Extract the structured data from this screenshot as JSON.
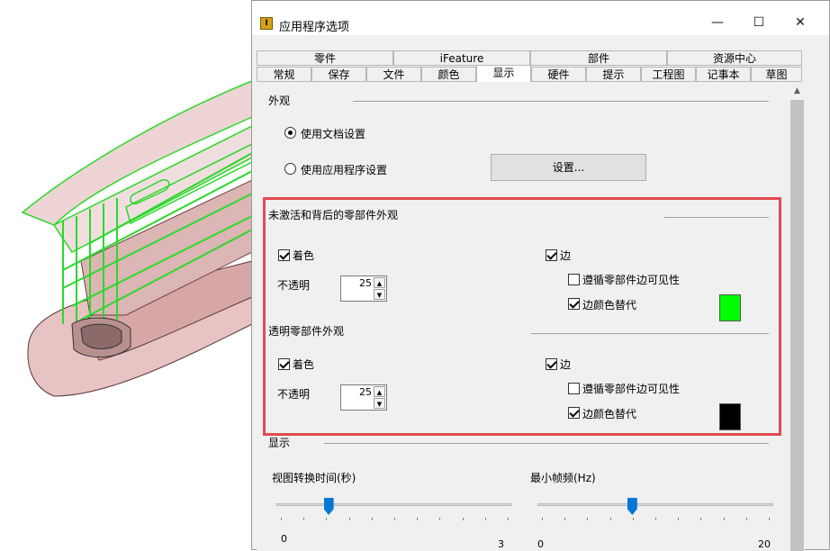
{
  "dialog": {
    "title": "应用程序选项",
    "icon_letter": "I",
    "controls": {
      "minimize": "—",
      "maximize": "☐",
      "close": "✕"
    }
  },
  "tabs": {
    "upper": [
      "零件",
      "iFeature",
      "部件",
      "资源中心"
    ],
    "lower": [
      "常规",
      "保存",
      "文件",
      "颜色",
      "显示",
      "硬件",
      "提示",
      "工程图",
      "记事本",
      "草图"
    ],
    "active": "显示"
  },
  "appearance": {
    "heading": "外观",
    "radio_document": "使用文档设置",
    "radio_application": "使用应用程序设置",
    "settings_button": "设置..."
  },
  "inactive": {
    "heading": "未激活和背后的零部件外观",
    "shaded": "着色",
    "opacity_label": "不透明",
    "opacity_value": "25",
    "edges": "边",
    "follow_visibility": "遵循零部件边可见性",
    "edge_color_override": "边颜色替代",
    "edge_color": "#00ff00"
  },
  "transparent": {
    "heading": "透明零部件外观",
    "shaded": "着色",
    "opacity_label": "不透明",
    "opacity_value": "25",
    "edges": "边",
    "follow_visibility": "遵循零部件边可见性",
    "edge_color_override": "边颜色替代",
    "edge_color": "#000000"
  },
  "display": {
    "heading": "显示",
    "view_transition_label": "视图转换时间(秒)",
    "view_transition_min": "0",
    "view_transition_max": "3",
    "view_transition_value_fraction": 0.22,
    "min_frame_rate_label": "最小帧频(Hz)",
    "min_frame_rate_min": "0",
    "min_frame_rate_max": "20",
    "min_frame_rate_value_fraction": 0.4
  },
  "colors": {
    "highlight_border": "#e24b50",
    "slider_thumb": "#0078d7"
  }
}
